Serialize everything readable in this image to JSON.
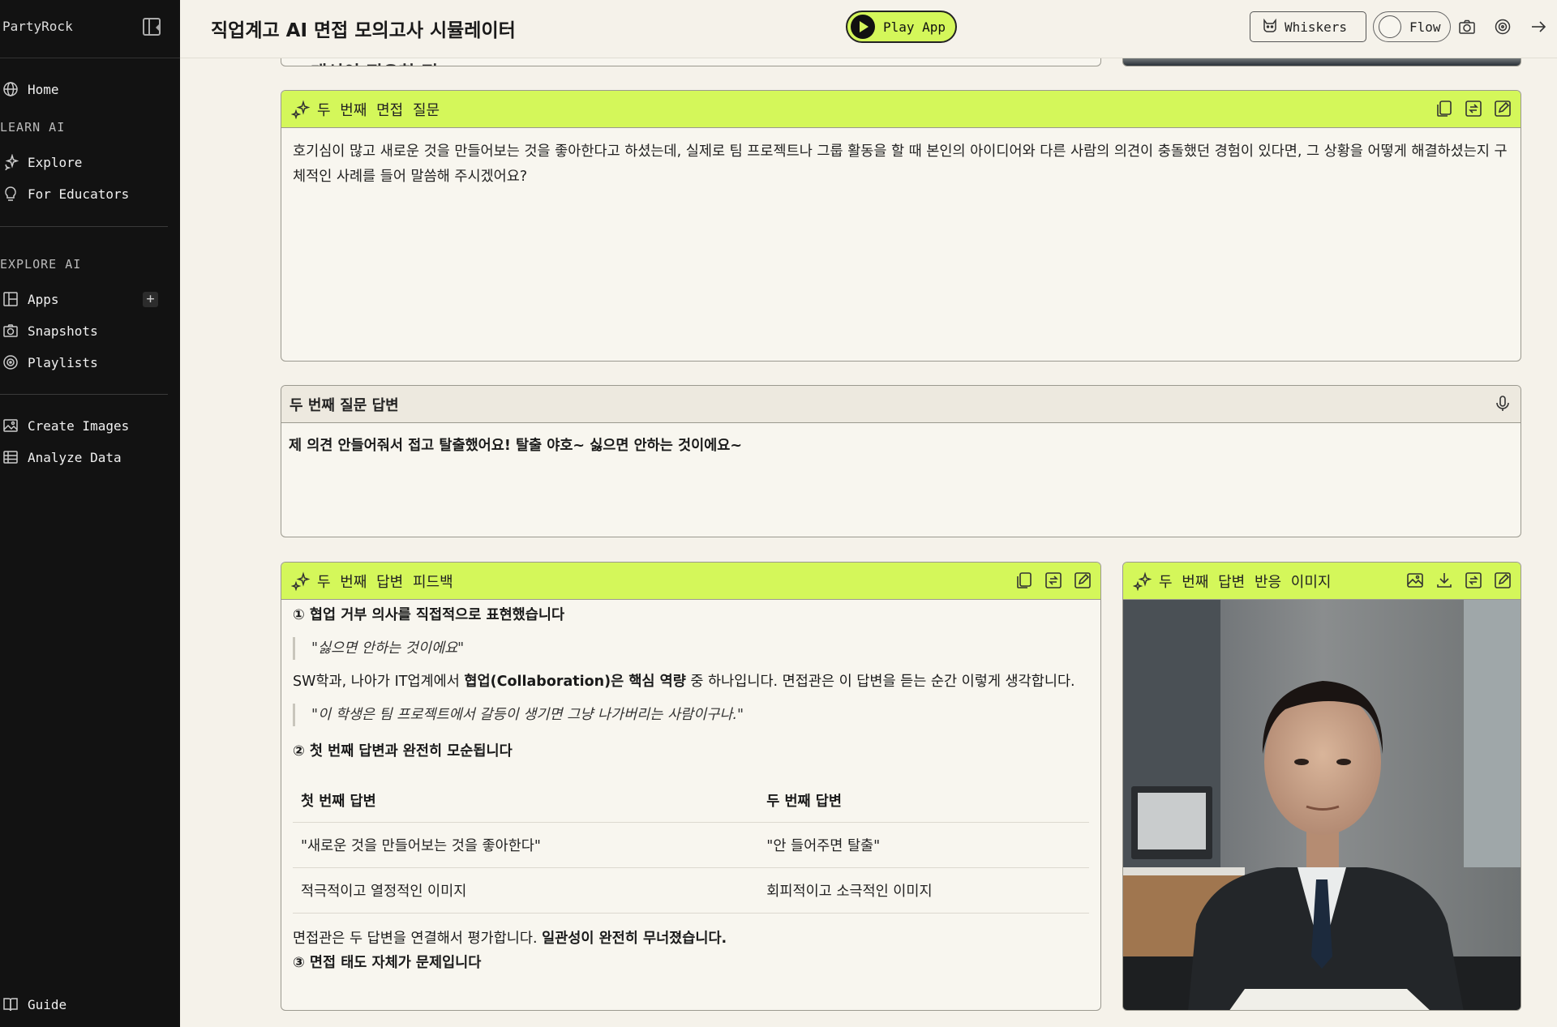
{
  "sidebar": {
    "brand": "PartyRock",
    "home": "Home",
    "learn_heading": "LEARN AI",
    "explore": "Explore",
    "educators": "For Educators",
    "explore_heading": "EXPLORE AI",
    "apps": "Apps",
    "snapshots": "Snapshots",
    "playlists": "Playlists",
    "create_images": "Create Images",
    "analyze_data": "Analyze Data",
    "guide": "Guide"
  },
  "header": {
    "title": "직업계고 AI 면접 모의고사 시뮬레이터",
    "play_label": "Play App",
    "whiskers_label": "Whiskers",
    "flow_label": "Flow"
  },
  "clipped": {
    "partial_heading": "개선이 필요한 점"
  },
  "question": {
    "title": "두 번째 면접 질문",
    "body": "호기심이 많고 새로운 것을 만들어보는 것을 좋아한다고 하셨는데, 실제로 팀 프로젝트나 그룹 활동을 할 때 본인의 아이디어와 다른 사람의 의견이 충돌했던 경험이 있다면, 그 상황을 어떻게 해결하셨는지 구체적인 사례를 들어 말씀해 주시겠어요?"
  },
  "answer": {
    "title": "두 번째 질문 답변",
    "value": "제 의견 안들어줘서 접고 탈출했어요! 탈출 야호~ 싫으면 안하는 것이에요~"
  },
  "feedback": {
    "title": "두 번째 답변 피드백",
    "h1": "① 협업 거부 의사를 직접적으로 표현했습니다",
    "q1": "\"싫으면 안하는 것이에요\"",
    "p1_pre": "SW학과, 나아가 IT업계에서 ",
    "p1_bold": "협업(Collaboration)은 핵심 역량",
    "p1_post": " 중 하나입니다. 면접관은 이 답변을 듣는 순간 이렇게 생각합니다.",
    "q2": "\"이 학생은 팀 프로젝트에서 갈등이 생기면 그냥 나가버리는 사람이구나.\"",
    "h2": "② 첫 번째 답변과 완전히 모순됩니다",
    "table": {
      "headers": [
        "첫 번째 답변",
        "두 번째 답변"
      ],
      "rows": [
        [
          "\"새로운 것을 만들어보는 것을 좋아한다\"",
          "\"안 들어주면 탈출\""
        ],
        [
          "적극적이고 열정적인 이미지",
          "회피적이고 소극적인 이미지"
        ]
      ]
    },
    "p2_pre": "면접관은 두 답변을 연결해서 평가합니다. ",
    "p2_bold": "일관성이 완전히 무너졌습니다.",
    "h3": "③ 면접 태도 자체가 문제입니다"
  },
  "image_panel": {
    "title": "두 번째 답변 반응 이미지"
  },
  "colors": {
    "accent": "#d4f75a",
    "sidebar_bg": "#121212",
    "page_bg": "#f5f2ea"
  }
}
